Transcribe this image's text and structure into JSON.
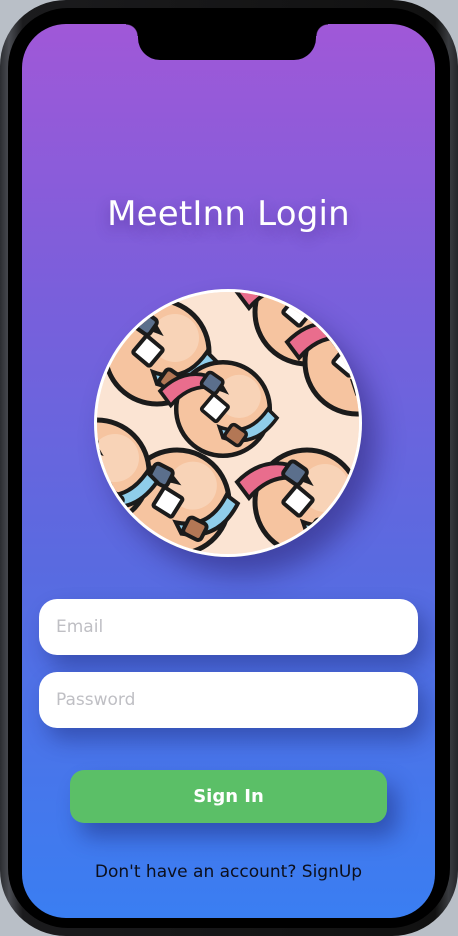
{
  "app": {
    "title": "MeetInn Login"
  },
  "logo": {
    "icon": "handshake-pattern-icon"
  },
  "form": {
    "email_placeholder": "Email",
    "email_value": "",
    "password_placeholder": "Password",
    "password_value": ""
  },
  "actions": {
    "signin_label": "Sign In",
    "signup_prompt": "Don't have an account? SignUp"
  },
  "colors": {
    "gradient_top": "#a058d8",
    "gradient_bottom": "#3a7ef2",
    "signin_button": "#5bbf67"
  }
}
